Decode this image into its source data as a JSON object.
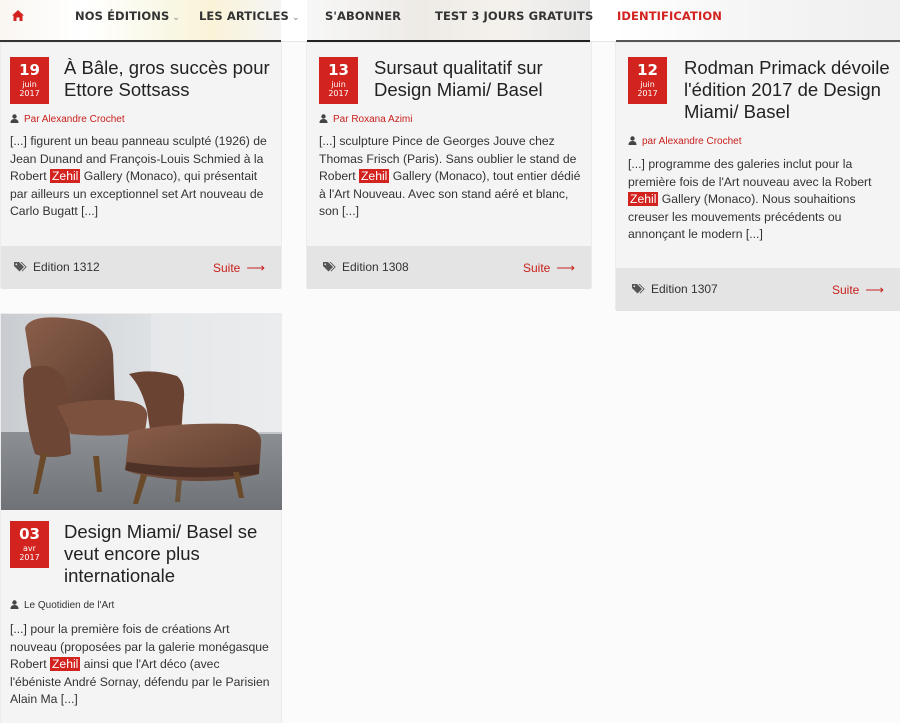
{
  "nav": {
    "home_icon": "home-icon",
    "items": [
      {
        "label": "NOS ÉDITIONS",
        "has_dropdown": true
      },
      {
        "label": "LES ARTICLES",
        "has_dropdown": true
      },
      {
        "label": "S'ABONNER",
        "has_dropdown": false
      },
      {
        "label": "TEST 3 JOURS GRATUITS",
        "has_dropdown": false
      },
      {
        "label": "IDENTIFICATION",
        "has_dropdown": false
      }
    ]
  },
  "colors": {
    "accent": "#d2231f",
    "footer": "#e4e4e4",
    "card": "#f4f4f4"
  },
  "articles": [
    {
      "day": "19",
      "month": "juin",
      "year": "2017",
      "title": "À Bâle, gros succès pour Ettore Sottsass",
      "author": "Par Alexandre Crochet",
      "excerpt_before": "[...] figurent un beau panneau sculpté (1926) de Jean Dunand and François-Louis Schmied à la Robert ",
      "highlight": "Zehil",
      "excerpt_after": " Gallery (Monaco), qui présentait par ailleurs un exceptionnel set Art nouveau de Carlo Bugatt [...]",
      "edition": "Edition 1312",
      "more": "Suite"
    },
    {
      "day": "13",
      "month": "juin",
      "year": "2017",
      "title": "Sursaut qualitatif sur Design Miami/ Basel",
      "author": "Par Roxana Azimi",
      "excerpt_before": "[...] sculpture Pince de Georges Jouve chez Thomas Frisch (Paris). Sans oublier le stand de Robert ",
      "highlight": "Zehil",
      "excerpt_after": " Gallery (Monaco), tout entier dédié à l'Art Nouveau. Avec son stand aéré et blanc, son [...]",
      "edition": "Edition 1308",
      "more": "Suite"
    },
    {
      "day": "12",
      "month": "juin",
      "year": "2017",
      "title": "Rodman Primack dévoile l'édition 2017 de Design Miami/ Basel",
      "author": "par Alexandre Crochet",
      "excerpt_before": "[...] programme des galeries inclut pour la première fois de l'Art nouveau avec la Robert ",
      "highlight": "Zehil",
      "excerpt_after": " Gallery (Monaco). Nous souhaitions creuser les mouvements précédents ou annonçant le modern [...]",
      "edition": "Edition 1307",
      "more": "Suite"
    },
    {
      "day": "03",
      "month": "avr",
      "year": "2017",
      "title": "Design Miami/ Basel se veut encore plus internationale",
      "author": "Le Quotidien de l'Art",
      "excerpt_before": "[...] pour la première fois de créations Art nouveau (proposées par la galerie monégasque Robert ",
      "highlight": "Zehil",
      "excerpt_after": " ainsi que l'Art déco (avec l'ébéniste André Sornay, défendu par le Parisien Alain Ma [...]"
    }
  ]
}
